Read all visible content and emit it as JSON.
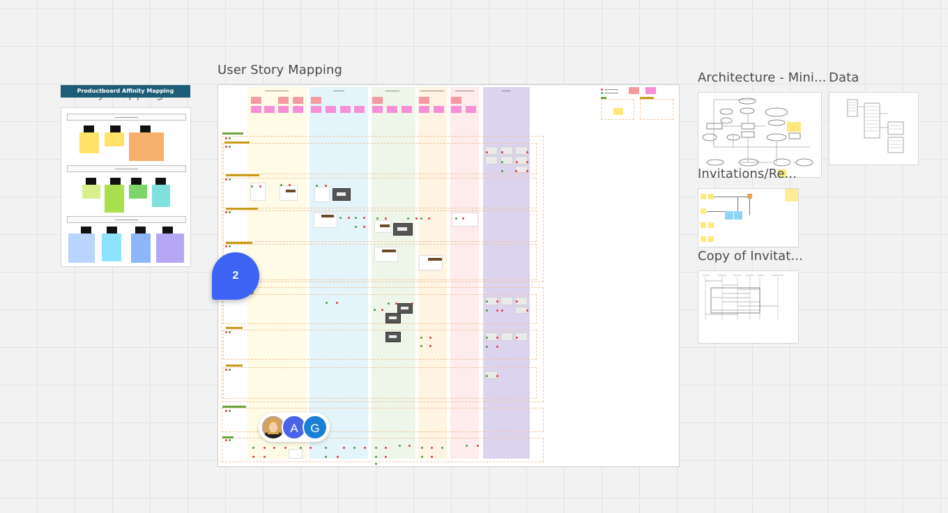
{
  "frames": {
    "affinity": {
      "title": "Affinity Mapping",
      "banner": "Productboard Affinity Mapping"
    },
    "story_map": {
      "title": "User Story Mapping"
    },
    "architecture": {
      "title": "Architecture - Mini..."
    },
    "data": {
      "title": "Data"
    },
    "invitations": {
      "title": "Invitations/Re..."
    },
    "copy_invitations": {
      "title": "Copy of Invitat..."
    }
  },
  "comment": {
    "count": "2",
    "color": "#3d63f5"
  },
  "collaborators": [
    {
      "initial": "",
      "kind": "photo"
    },
    {
      "initial": "A",
      "color": "#4a63e8"
    },
    {
      "initial": "G",
      "color": "#1b7fd6"
    }
  ],
  "colors": {
    "canvas": "#f2f2f2",
    "sticky_yellow": "#ffe97a",
    "sticky_pink": "#f78fd8",
    "sticky_red": "#f59aa0",
    "col_yellow": "#fffbe6",
    "col_blue": "#e3f4fa",
    "col_green": "#eef6ea",
    "col_orange": "#fff3e2",
    "col_red": "#fdeceb",
    "col_purple": "#dcd4ee"
  }
}
